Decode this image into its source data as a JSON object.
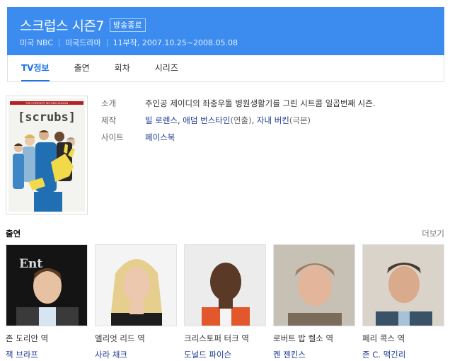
{
  "header": {
    "title": "스크럽스 시즌7",
    "status_badge": "방송종료",
    "meta": [
      "미국 NBC",
      "미국드라마",
      "11부작, 2007.10.25~2008.05.08"
    ]
  },
  "tabs": [
    "TV정보",
    "출연",
    "회차",
    "시리즈"
  ],
  "poster": {
    "banner_text": "THE COMPLETE SECOND SEASON",
    "logo_text": "[scrubs]"
  },
  "info": {
    "intro_label": "소개",
    "intro_text": "주인공 제이디의 좌충우돌 병원생활기를 그린 시트콤 일곱번째 시즌.",
    "production_label": "제작",
    "producers": [
      {
        "name": "빌 로렌스",
        "role": ""
      },
      {
        "name": "애덤 번스타인",
        "role": "(연출)"
      },
      {
        "name": "자내 버킨",
        "role": "(극본)"
      }
    ],
    "site_label": "사이트",
    "site_link": "페이스북"
  },
  "cast_section": {
    "title": "출연",
    "more": "더보기",
    "members": [
      {
        "role": "존 도리안 역",
        "actor": "잭 브라프"
      },
      {
        "role": "엘리엇 리드 역",
        "actor": "사라 채크"
      },
      {
        "role": "크리스토퍼 터크 역",
        "actor": "도널드 파이슨"
      },
      {
        "role": "로버트 밥 켈소 역",
        "actor": "켄 젠킨스"
      },
      {
        "role": "페리 콕스 역",
        "actor": "존 C. 맥긴리"
      }
    ]
  },
  "colors": {
    "header_bg": "#3c8cf0",
    "active_tab": "#1a73e8",
    "link": "#1e3c94"
  }
}
